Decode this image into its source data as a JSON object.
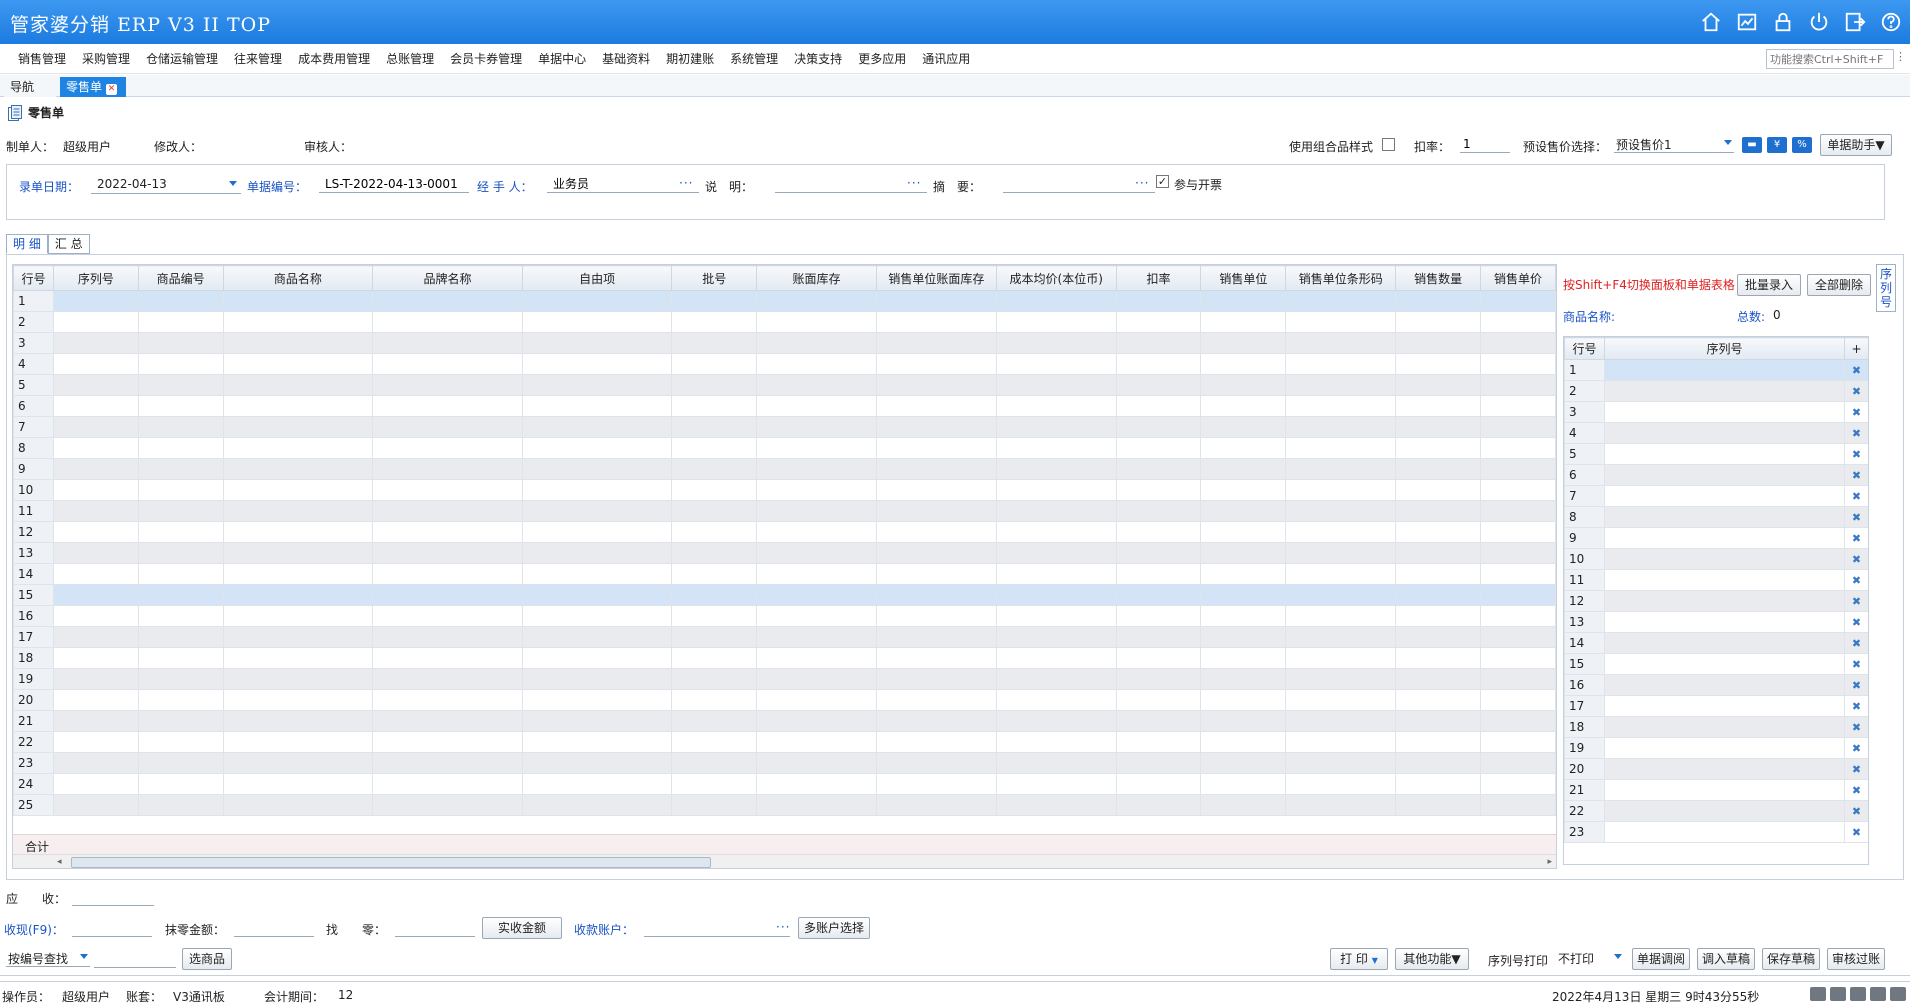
{
  "app": {
    "title": "管家婆分销 ERP V3 II TOP"
  },
  "menu": {
    "items": [
      "销售管理",
      "采购管理",
      "仓储运输管理",
      "往来管理",
      "成本费用管理",
      "总账管理",
      "会员卡券管理",
      "单据中心",
      "基础资料",
      "期初建账",
      "系统管理",
      "决策支持",
      "更多应用",
      "通讯应用"
    ],
    "search_placeholder": "功能搜索Ctrl+Shift+F"
  },
  "tabs": {
    "nav": "导航",
    "current": "零售单"
  },
  "doc": {
    "title": "零售单"
  },
  "meta": {
    "creator_label": "制单人：",
    "creator": "超级用户",
    "modifier_label": "修改人：",
    "auditor_label": "审核人：",
    "combo_label": "使用组合品样式",
    "discount_label": "扣率：",
    "discount": "1",
    "preset_label": "预设售价选择：",
    "preset": "预设售价1",
    "assistant": "单据助手▼"
  },
  "header": {
    "date_label": "录单日期：",
    "date": "2022-04-13",
    "billno_label": "单据编号：",
    "billno": "LS-T-2022-04-13-0001",
    "handler_label": "经 手 人：",
    "handler": "业务员",
    "note_label": "说　明：",
    "summary_label": "摘　要：",
    "invoice_label": "参与开票",
    "dots": "···"
  },
  "detail_tabs": [
    "明 细",
    "汇 总"
  ],
  "grid": {
    "columns": [
      "行号",
      "序列号",
      "商品编号",
      "商品名称",
      "品牌名称",
      "自由项",
      "批号",
      "账面库存",
      "销售单位账面库存",
      "成本均价(本位币)",
      "扣率",
      "销售单位",
      "销售单位条形码",
      "销售数量",
      "销售单价"
    ],
    "rows": [
      "1",
      "2",
      "3",
      "4",
      "5",
      "6",
      "7",
      "8",
      "9",
      "10",
      "11",
      "12",
      "13",
      "14",
      "15",
      "16",
      "17",
      "18",
      "19",
      "20",
      "21",
      "22",
      "23",
      "24",
      "25"
    ],
    "total_label": "合计"
  },
  "side": {
    "hint": "按Shift+F4切换面板和单据表格",
    "batch_button": "批量录入",
    "clear_button": "全部删除",
    "name_label": "商品名称:",
    "total_label": "总数:",
    "total": "0",
    "columns": [
      "行号",
      "序列号",
      "+"
    ],
    "rows": [
      "1",
      "2",
      "3",
      "4",
      "5",
      "6",
      "7",
      "8",
      "9",
      "10",
      "11",
      "12",
      "13",
      "14",
      "15",
      "16",
      "17",
      "18",
      "19",
      "20",
      "21",
      "22",
      "23"
    ],
    "tab_label": "序列号"
  },
  "bottom": {
    "receivable_label": "应　　收：",
    "cash_label": "收现(F9)：",
    "wipe_label": "抹零金额：",
    "change_label": "找　　零：",
    "actual_button": "实收金额",
    "account_label": "收款账户：",
    "multi_account_button": "多账户选择",
    "search_mode": "按编号查找",
    "select_goods_button": "选商品",
    "print_button": "打 印",
    "other_button": "其他功能▼",
    "serial_print_label": "序列号打印",
    "serial_print_value": "不打印",
    "call_button": "单据调阅",
    "load_draft_button": "调入草稿",
    "save_draft_button": "保存草稿",
    "audit_button": "审核过账"
  },
  "status": {
    "operator_label": "操作员：",
    "operator": "超级用户",
    "account_label": "账套：",
    "account": "V3通讯板",
    "period_label": "会计期间：",
    "period": "12",
    "datetime": "2022年4月13日  星期三  9时43分55秒"
  }
}
